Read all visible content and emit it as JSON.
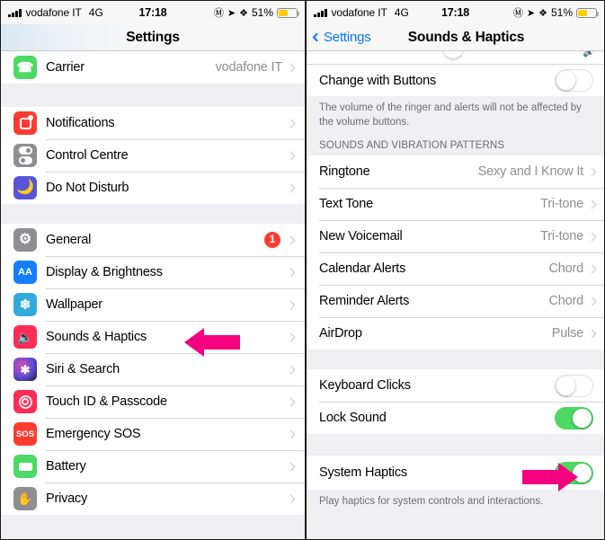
{
  "status_bar": {
    "carrier": "vodafone IT",
    "network": "4G",
    "time": "17:18",
    "battery_percent": "51%",
    "icons": [
      "signal-bars-icon",
      "at-icon",
      "location-arrow-icon",
      "bluetooth-icon",
      "battery-icon"
    ]
  },
  "left_panel": {
    "nav": {
      "title": "Settings"
    },
    "groups": [
      {
        "rows": [
          {
            "label": "Carrier",
            "value": "vodafone IT",
            "icon": "phone-icon",
            "icon_color": "#4cd964",
            "chevron": true
          }
        ]
      },
      {
        "rows": [
          {
            "label": "Notifications",
            "icon": "notifications-icon",
            "icon_color": "#ff3b30",
            "chevron": true
          },
          {
            "label": "Control Centre",
            "icon": "control-centre-icon",
            "icon_color": "#8e8e93",
            "chevron": true
          },
          {
            "label": "Do Not Disturb",
            "icon": "moon-icon",
            "icon_color": "#5856d6",
            "chevron": true
          }
        ]
      },
      {
        "rows": [
          {
            "label": "General",
            "icon": "gear-icon",
            "icon_color": "#8e8e93",
            "badge": "1",
            "chevron": true
          },
          {
            "label": "Display & Brightness",
            "icon": "display-brightness-icon",
            "icon_color": "#147efb",
            "chevron": true
          },
          {
            "label": "Wallpaper",
            "icon": "wallpaper-icon",
            "icon_color": "#34aadc",
            "chevron": true
          },
          {
            "label": "Sounds & Haptics",
            "icon": "speaker-icon",
            "icon_color": "#ff2d55",
            "chevron": true,
            "highlighted": true
          },
          {
            "label": "Siri & Search",
            "icon": "siri-icon",
            "icon_color": "#1c1c2e",
            "chevron": true
          },
          {
            "label": "Touch ID & Passcode",
            "icon": "fingerprint-icon",
            "icon_color": "#ff2d55",
            "chevron": true
          },
          {
            "label": "Emergency SOS",
            "icon": "sos-icon",
            "icon_color": "#ff3b30",
            "chevron": true
          },
          {
            "label": "Battery",
            "icon": "battery-icon",
            "icon_color": "#4cd964",
            "chevron": true
          },
          {
            "label": "Privacy",
            "icon": "hand-icon",
            "icon_color": "#8e8e93",
            "chevron": true
          }
        ]
      }
    ]
  },
  "right_panel": {
    "nav": {
      "back_label": "Settings",
      "title": "Sounds & Haptics"
    },
    "ringer_group": {
      "rows": [
        {
          "label": "Change with Buttons",
          "toggle": "off"
        }
      ],
      "footer": "The volume of the ringer and alerts will not be affected by the volume buttons."
    },
    "sounds_group": {
      "header": "SOUNDS AND VIBRATION PATTERNS",
      "rows": [
        {
          "label": "Ringtone",
          "value": "Sexy and I Know It",
          "chevron": true
        },
        {
          "label": "Text Tone",
          "value": "Tri-tone",
          "chevron": true
        },
        {
          "label": "New Voicemail",
          "value": "Tri-tone",
          "chevron": true
        },
        {
          "label": "Calendar Alerts",
          "value": "Chord",
          "chevron": true
        },
        {
          "label": "Reminder Alerts",
          "value": "Chord",
          "chevron": true
        },
        {
          "label": "AirDrop",
          "value": "Pulse",
          "chevron": true
        }
      ]
    },
    "clicks_group": {
      "rows": [
        {
          "label": "Keyboard Clicks",
          "toggle": "off"
        },
        {
          "label": "Lock Sound",
          "toggle": "on"
        }
      ]
    },
    "haptics_group": {
      "rows": [
        {
          "label": "System Haptics",
          "toggle": "on",
          "highlighted": true
        }
      ],
      "footer": "Play haptics for system controls and interactions."
    }
  },
  "annotations": {
    "arrow_color": "#f5007e",
    "arrows": [
      {
        "name": "arrow-pointing-sounds-haptics",
        "direction": "left"
      },
      {
        "name": "arrow-pointing-system-haptics-toggle",
        "direction": "right"
      }
    ]
  }
}
